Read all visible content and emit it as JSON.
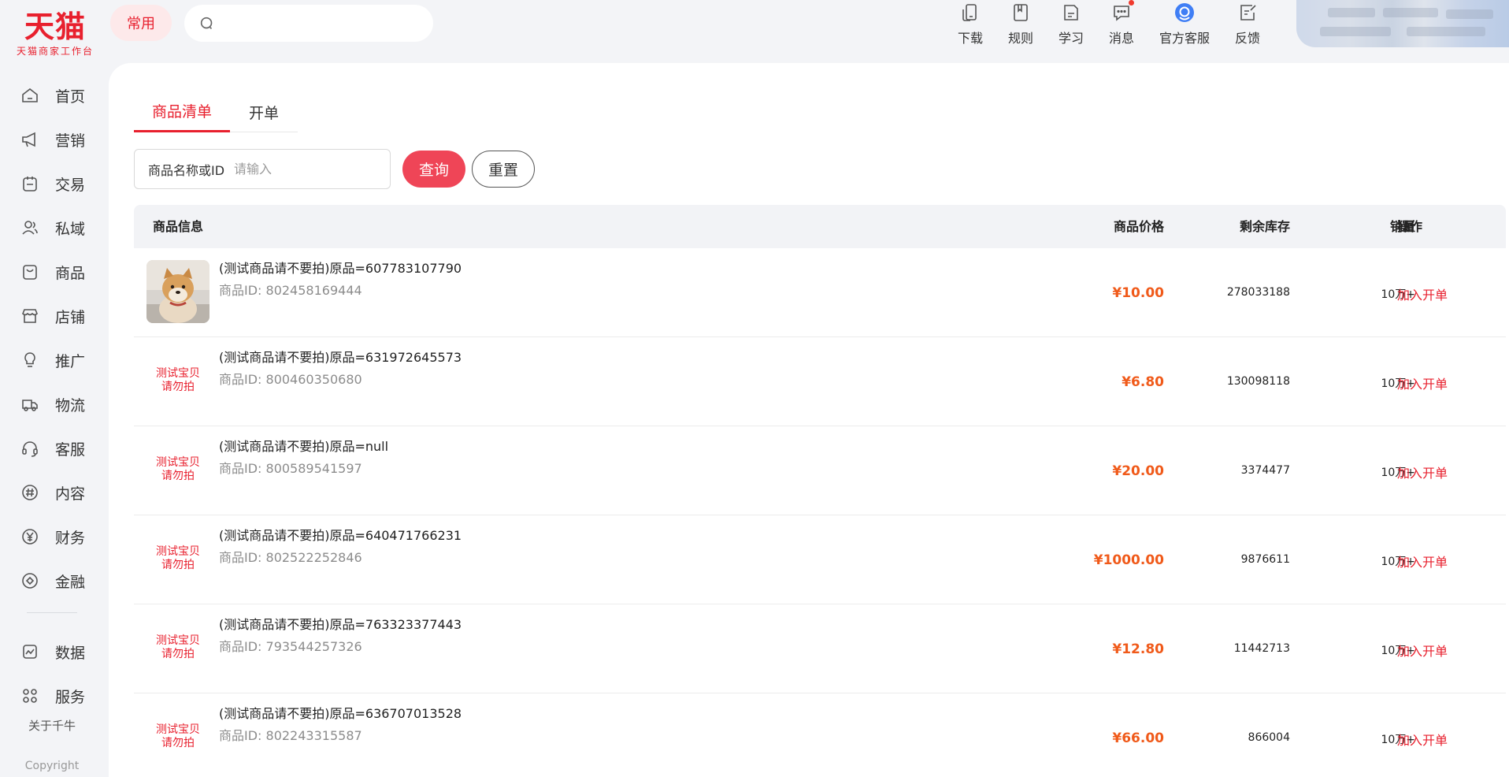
{
  "app": {
    "logo_main": "天猫",
    "logo_sub": "天猫商家工作台",
    "common_label": "常用",
    "search_placeholder": ""
  },
  "top_tools": [
    {
      "label": "下载",
      "icon": "download-icon"
    },
    {
      "label": "规则",
      "icon": "rules-icon"
    },
    {
      "label": "学习",
      "icon": "learn-icon"
    },
    {
      "label": "消息",
      "icon": "message-icon"
    },
    {
      "label": "官方客服",
      "icon": "official-service-icon"
    },
    {
      "label": "反馈",
      "icon": "feedback-icon"
    }
  ],
  "sidebar": {
    "items": [
      {
        "label": "首页",
        "icon": "home-icon"
      },
      {
        "label": "营销",
        "icon": "megaphone-icon"
      },
      {
        "label": "交易",
        "icon": "trade-icon"
      },
      {
        "label": "私域",
        "icon": "users-icon"
      },
      {
        "label": "商品",
        "icon": "bag-icon"
      },
      {
        "label": "店铺",
        "icon": "store-icon"
      },
      {
        "label": "推广",
        "icon": "bulb-icon"
      },
      {
        "label": "物流",
        "icon": "truck-icon"
      },
      {
        "label": "客服",
        "icon": "headset-icon"
      },
      {
        "label": "内容",
        "icon": "hash-icon"
      },
      {
        "label": "财务",
        "icon": "yen-icon"
      },
      {
        "label": "金融",
        "icon": "diamond-icon"
      },
      {
        "label": "数据",
        "icon": "chart-icon"
      },
      {
        "label": "服务",
        "icon": "grid-icon"
      }
    ],
    "about": "关于千牛",
    "copyright": "Copyright"
  },
  "tabs": [
    {
      "label": "商品清单",
      "active": true
    },
    {
      "label": "开单",
      "active": false
    }
  ],
  "filter": {
    "label": "商品名称或ID",
    "placeholder": "请输入",
    "query_label": "查询",
    "reset_label": "重置"
  },
  "table": {
    "headers": {
      "info": "商品信息",
      "price": "商品价格",
      "stock": "剩余库存",
      "sales": "销量",
      "action": "操作"
    },
    "rows": [
      {
        "thumb": "photo",
        "name": "(测试商品请不要拍)原品=607783107790",
        "id": "商品ID: 802458169444",
        "price": "¥10.00",
        "stock": "278033188",
        "sales": "10万+",
        "action": "加入开单"
      },
      {
        "thumb": "text",
        "thumb_line1": "测试宝贝",
        "thumb_line2": "请勿拍",
        "name": "(测试商品请不要拍)原品=631972645573",
        "id": "商品ID: 800460350680",
        "price": "¥6.80",
        "stock": "130098118",
        "sales": "10万+",
        "action": "加入开单"
      },
      {
        "thumb": "text",
        "thumb_line1": "测试宝贝",
        "thumb_line2": "请勿拍",
        "name": "(测试商品请不要拍)原品=null",
        "id": "商品ID: 800589541597",
        "price": "¥20.00",
        "stock": "3374477",
        "sales": "10万+",
        "action": "加入开单"
      },
      {
        "thumb": "text",
        "thumb_line1": "测试宝贝",
        "thumb_line2": "请勿拍",
        "name": "(测试商品请不要拍)原品=640471766231",
        "id": "商品ID: 802522252846",
        "price": "¥1000.00",
        "stock": "9876611",
        "sales": "10万+",
        "action": "加入开单"
      },
      {
        "thumb": "text",
        "thumb_line1": "测试宝贝",
        "thumb_line2": "请勿拍",
        "name": "(测试商品请不要拍)原品=763323377443",
        "id": "商品ID: 793544257326",
        "price": "¥12.80",
        "stock": "11442713",
        "sales": "10万+",
        "action": "加入开单"
      },
      {
        "thumb": "text",
        "thumb_line1": "测试宝贝",
        "thumb_line2": "请勿拍",
        "name": "(测试商品请不要拍)原品=636707013528",
        "id": "商品ID: 802243315587",
        "price": "¥66.00",
        "stock": "866004",
        "sales": "10万+",
        "action": "加入开单"
      }
    ]
  },
  "colors": {
    "brand_red": "#e8202e",
    "query_button": "#ef4557",
    "price_orange": "#f05a1a"
  }
}
